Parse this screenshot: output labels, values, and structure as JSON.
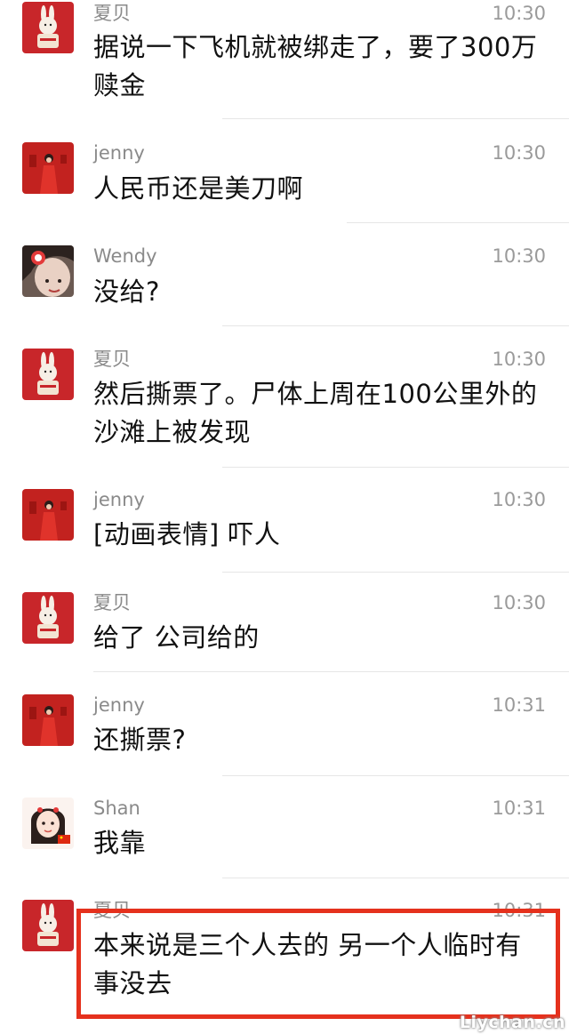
{
  "messages": [
    {
      "sender": "夏贝",
      "avatar": "bunny-avatar",
      "time": "10:30",
      "text": "据说一下飞机就被绑走了，要了300万赎金"
    },
    {
      "sender": "jenny",
      "avatar": "red-dress-avatar",
      "time": "10:30",
      "text": "人民币还是美刀啊"
    },
    {
      "sender": "Wendy",
      "avatar": "face-avatar",
      "time": "10:30",
      "text": "没给?"
    },
    {
      "sender": "夏贝",
      "avatar": "bunny-avatar",
      "time": "10:30",
      "text": "然后撕票了。尸体上周在100公里外的沙滩上被发现"
    },
    {
      "sender": "jenny",
      "avatar": "red-dress-avatar",
      "time": "10:30",
      "text": "[动画表情] 吓人"
    },
    {
      "sender": "夏贝",
      "avatar": "bunny-avatar",
      "time": "10:30",
      "text": "给了 公司给的"
    },
    {
      "sender": "jenny",
      "avatar": "red-dress-avatar",
      "time": "10:31",
      "text": "还撕票?"
    },
    {
      "sender": "Shan",
      "avatar": "girl-flag-avatar",
      "time": "10:31",
      "text": "我靠"
    },
    {
      "sender": "夏贝",
      "avatar": "bunny-avatar",
      "time": "10:31",
      "text": "本来说是三个人去的 另一个人临时有事没去"
    }
  ],
  "highlight_color": "#e5311d",
  "watermark": "Liychan.cn"
}
